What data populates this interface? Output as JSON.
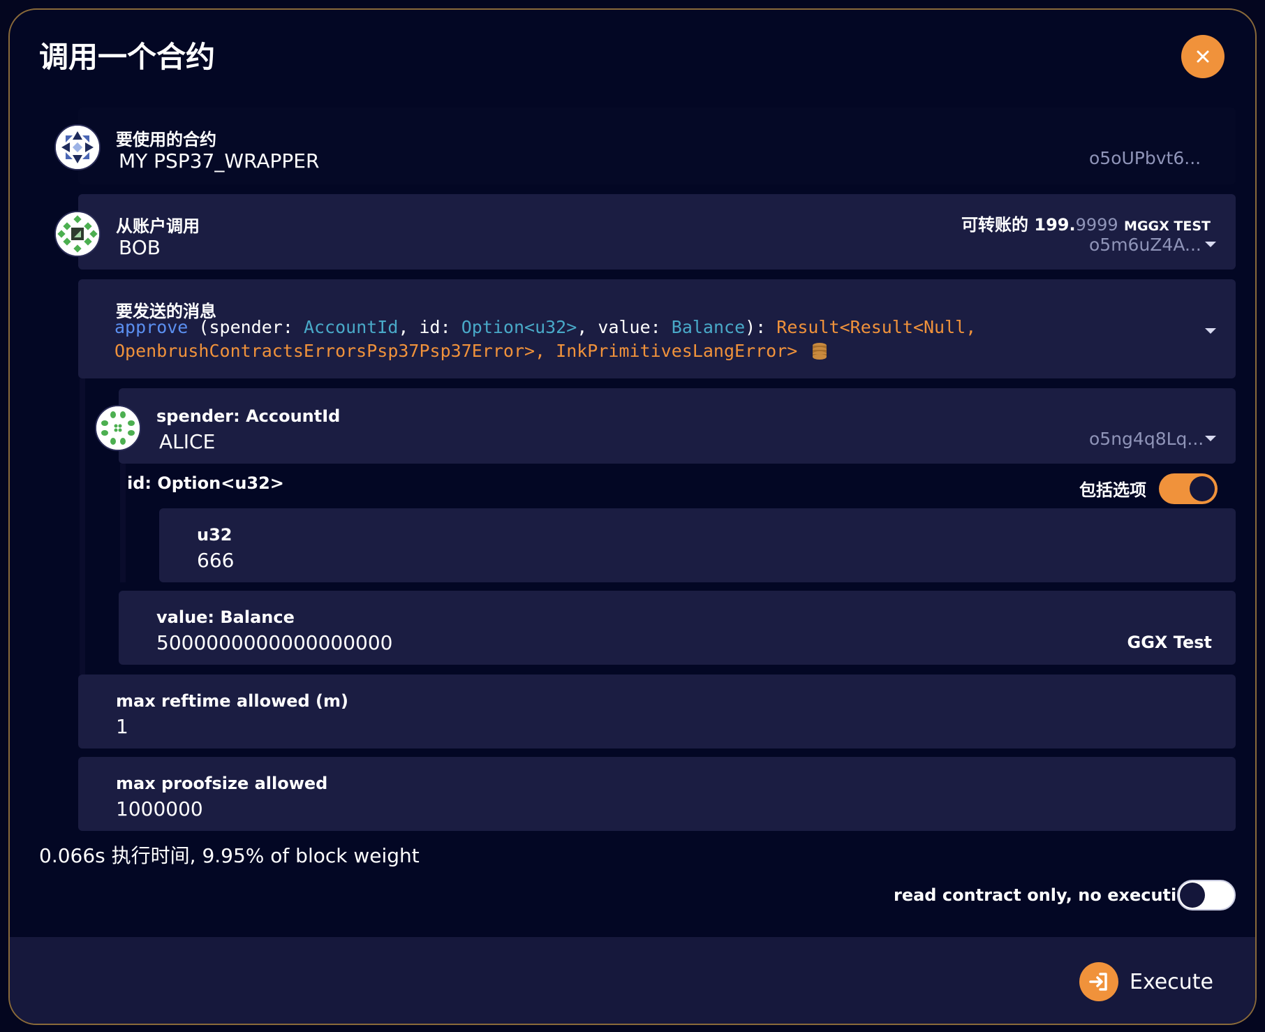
{
  "dialog": {
    "title": "调用一个合约",
    "close_icon": "close-icon"
  },
  "contract": {
    "label": "要使用的合约",
    "name": "MY PSP37_WRAPPER",
    "address": "o5oUPbvt6..."
  },
  "caller": {
    "label": "从账户调用",
    "name": "BOB",
    "balance_label": "可转账的",
    "balance_int": "199.",
    "balance_dec": "9999",
    "balance_unit": "MGGX TEST",
    "address": "o5m6uZ4A..."
  },
  "message": {
    "label": "要发送的消息",
    "fn": "approve",
    "p1": " (spender: ",
    "t1": "AccountId",
    "p2": ", id: ",
    "t2": "Option<u32>",
    "p3": ", value: ",
    "t3": "Balance",
    "p4": "): ",
    "ret1": "Result<Result<Null,",
    "ret2": "OpenbrushContractsErrorsPsp37Psp37Error>, InkPrimitivesLangError>",
    "payable_icon": "coins-icon"
  },
  "spender": {
    "label": "spender: AccountId",
    "name": "ALICE",
    "address": "o5ng4q8Lq..."
  },
  "id_param": {
    "label": "id: Option<u32>",
    "include_label": "包括选项",
    "include_on": true
  },
  "u32": {
    "label": "u32",
    "value": "666"
  },
  "value_param": {
    "label": "value: Balance",
    "value": "5000000000000000000",
    "unit": "GGX Test"
  },
  "reftime": {
    "label": "max reftime allowed (m)",
    "value": "1"
  },
  "proofsize": {
    "label": "max proofsize allowed",
    "value": "1000000"
  },
  "estimate": "0.066s 执行时间, 9.95% of block weight",
  "read_only": {
    "label": "read contract only, no execution",
    "on": false
  },
  "execute": {
    "label": "Execute",
    "icon": "sign-in-icon"
  },
  "colors": {
    "accent": "#f0923b",
    "background": "#030724",
    "panel": "#1b1d42",
    "fn": "#5b8ff0",
    "type": "#49a9c8"
  }
}
